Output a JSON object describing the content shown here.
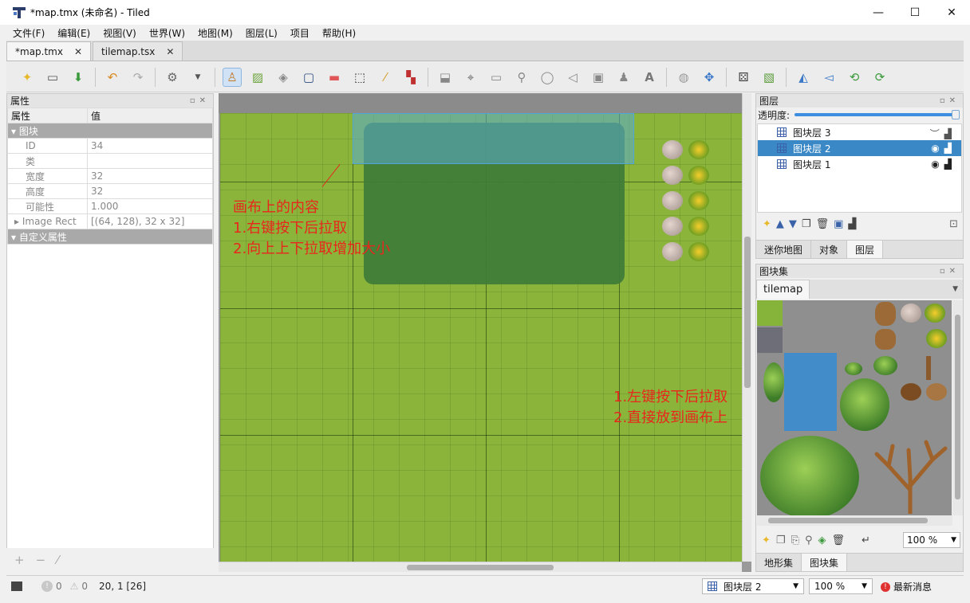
{
  "window": {
    "title": "*map.tmx (未命名) - Tiled",
    "minimize": "—",
    "maximize": "☐",
    "close": "✕"
  },
  "menu": [
    "文件(F)",
    "编辑(E)",
    "视图(V)",
    "世界(W)",
    "地图(M)",
    "图层(L)",
    "项目",
    "帮助(H)"
  ],
  "tabs": [
    {
      "label": "*map.tmx",
      "close": "✕"
    },
    {
      "label": "tilemap.tsx",
      "close": "✕"
    }
  ],
  "properties_panel": {
    "title": "属性",
    "col_name": "属性",
    "col_value": "值",
    "group_tile": "图块",
    "rows": [
      {
        "key": "ID",
        "value": "34"
      },
      {
        "key": "类",
        "value": ""
      },
      {
        "key": "宽度",
        "value": "32"
      },
      {
        "key": "高度",
        "value": "32"
      },
      {
        "key": "可能性",
        "value": "1.000"
      },
      {
        "key": "Image Rect",
        "value": "[(64, 128), 32 x 32]"
      }
    ],
    "group_custom": "自定义属性"
  },
  "canvas": {
    "annotation_title": "画布上的内容",
    "annotation_line1": "1.右键按下后拉取",
    "annotation_line2": "2.向上上下拉取增加大小"
  },
  "layers_panel": {
    "title": "图层",
    "opacity_label": "透明度:",
    "opacity": 1.0,
    "layers": [
      {
        "name": "图块层 3",
        "selected": false
      },
      {
        "name": "图块层 2",
        "selected": true
      },
      {
        "name": "图块层 1",
        "selected": false
      }
    ],
    "tabs": [
      "迷你地图",
      "对象",
      "图层"
    ],
    "active_tab": "图层"
  },
  "tileset_panel": {
    "title": "图块集",
    "tileset_tab": "tilemap",
    "annotation_line1": "1.左键按下后拉取",
    "annotation_line2": "2.直接放到画布上",
    "zoom": "100 %",
    "tabs": [
      "地形集",
      "图块集"
    ],
    "active_tab": "图块集"
  },
  "statusbar": {
    "errors": "0",
    "warnings": "0",
    "cursor": "20, 1 [26]",
    "layer_select": "图块层 2",
    "zoom": "100 %",
    "news": "最新消息"
  },
  "colors": {
    "accent": "#3b88c7",
    "annotation": "#e8261c",
    "grass": "#8ab53a"
  }
}
